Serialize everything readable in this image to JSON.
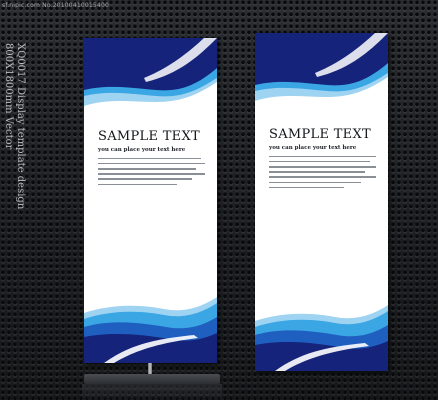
{
  "watermark": "sf.nipic.com No.20100410015400",
  "side_caption": {
    "line1": "XQ0017 Display template design",
    "line2": "800X1800mm Vector"
  },
  "banners": [
    {
      "headline": "SAMPLE TEXT",
      "subline": "you can place your text here",
      "line_count": 6
    },
    {
      "headline": "SAMPLE TEXT",
      "subline": "you can place your text here",
      "line_count": 7
    }
  ],
  "colors": {
    "navy": "#15237a",
    "blue": "#1f5fc0",
    "cyan": "#3aa6e3",
    "light": "#9fd3f2"
  }
}
